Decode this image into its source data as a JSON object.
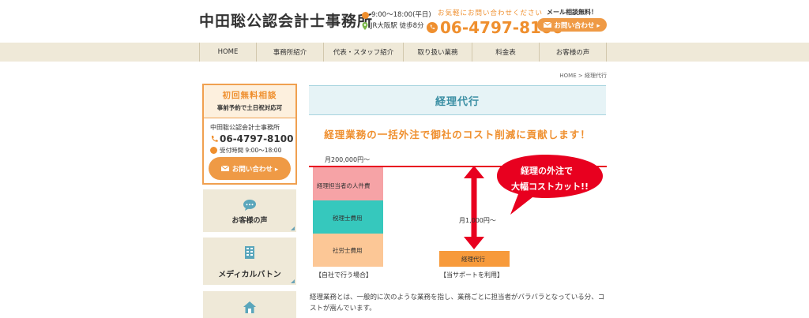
{
  "header": {
    "site_title": "中田聡公認会計士事務所",
    "hours": "9:00〜18:00(平日)",
    "access": "JR大阪駅 徒歩8分",
    "contact_sub": "お気軽にお問い合わせください",
    "tel": "06-4797-8100",
    "mail_sub": "メール相談無料！",
    "mail_button": "お問い合わせ ▸"
  },
  "nav": {
    "items": [
      "HOME",
      "事務所紹介",
      "代表・スタッフ紹介",
      "取り扱い業務",
      "料金表",
      "お客様の声"
    ]
  },
  "breadcrumb": {
    "home": "HOME",
    "sep": ">",
    "current": "経理代行"
  },
  "sidebar": {
    "consult_title": "初回無料相談",
    "consult_sub": "事前予約で土日祝対応可",
    "office_name": "中田聡公認会計士事務所",
    "tel": "06-4797-8100",
    "hours": "受付時間 9:00〜18:00",
    "button": "お問い合わせ ▸",
    "cards": [
      "お客様の声",
      "メディカルバトン"
    ]
  },
  "main": {
    "heading": "経理代行",
    "lead": "経理業務の一括外注で御社のコスト削減に貢献します！",
    "body": "経理業務とは、一般的に次のような業務を指し、業務ごとに担当者がバラバラとなっている分、コストが嵩んでいます。"
  },
  "chart_data": {
    "type": "bar",
    "categories": [
      "【自社で行う場合】",
      "【当サポートを利用】"
    ],
    "series": [
      {
        "name": "経理担当者の人件費",
        "color": "#f6a3a6"
      },
      {
        "name": "税理士費用",
        "color": "#36c8bd"
      },
      {
        "name": "社労士費用",
        "color": "#fcc796"
      },
      {
        "name": "経理代行",
        "color": "#f79a3b"
      }
    ],
    "value_labels": [
      "月200,000円〜",
      "月1,000円〜"
    ],
    "callout": [
      "経理の外注で",
      "大幅コストカット!!"
    ],
    "colors": {
      "line": "#e8001f",
      "arrow": "#e8001f",
      "bubble": "#e8001f"
    }
  }
}
